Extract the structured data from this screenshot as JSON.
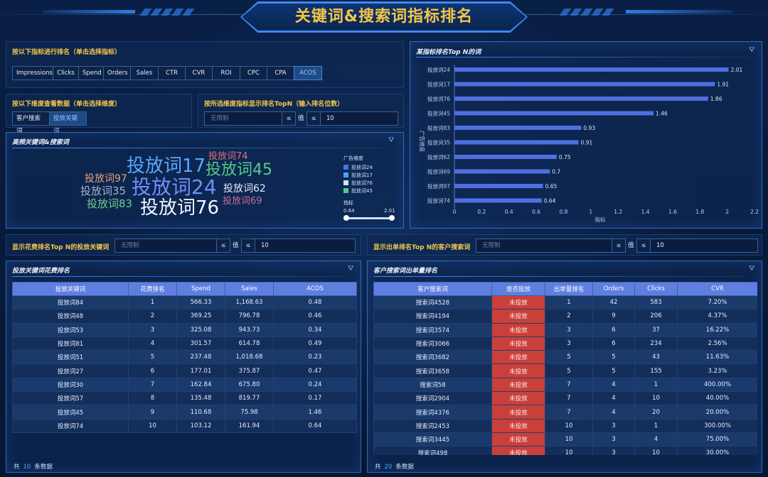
{
  "header": {
    "title": "关键词&搜索词指标排名"
  },
  "metric_selector": {
    "label": "按以下指标进行排名（单击选择指标）",
    "options": [
      "Impressions",
      "Clicks",
      "Spend",
      "Orders",
      "Sales",
      "CTR",
      "CVR",
      "ROI",
      "CPC",
      "CPA",
      "ACOS"
    ],
    "selected": "ACOS"
  },
  "dimension_selector": {
    "label": "按以下维度查看数据（单击选择维度）",
    "options": [
      "客户搜索词",
      "投放关键词"
    ],
    "selected": "投放关键词"
  },
  "topn_filter": {
    "label": "按所选维度指标显示排名TopN（输入排名位数）",
    "placeholder": "无限制",
    "op_icon": "≤",
    "value_label": "值",
    "value": "10"
  },
  "word_cloud": {
    "title": "高频关键词&搜索词",
    "words": [
      {
        "text": "投放词74",
        "color": "#e0707a"
      },
      {
        "text": "投放词17",
        "color": "#5aa7ff"
      },
      {
        "text": "投放词45",
        "color": "#56c98a"
      },
      {
        "text": "投放词97",
        "color": "#e8a07a"
      },
      {
        "text": "投放词24",
        "color": "#6f8fff"
      },
      {
        "text": "投放词62",
        "color": "#e4ecff"
      },
      {
        "text": "投放词35",
        "color": "#a7b3cf"
      },
      {
        "text": "投放词69",
        "color": "#c76ca0"
      },
      {
        "text": "投放词83",
        "color": "#71d08c"
      },
      {
        "text": "投放词76",
        "color": "#f2f6ff"
      }
    ],
    "legend_title": "广告维度",
    "legend": [
      {
        "label": "投放词24",
        "color": "#4f6fe0"
      },
      {
        "label": "投放词17",
        "color": "#4aa2ff"
      },
      {
        "label": "投放词76",
        "color": "#cfe2ff"
      },
      {
        "label": "投放词45",
        "color": "#56c98a"
      }
    ],
    "slider_title": "指标",
    "slider_min": "0.64",
    "slider_max": "2.01"
  },
  "bar_panel": {
    "title": "某指标排名Top  N的词"
  },
  "chart_data": {
    "type": "bar",
    "orientation": "horizontal",
    "categories": [
      "投放词24",
      "投放词17",
      "投放词76",
      "投放词45",
      "投放词83",
      "投放词35",
      "投放词62",
      "投放词69",
      "投放词97",
      "投放词74"
    ],
    "values": [
      2.01,
      1.91,
      1.86,
      1.46,
      0.93,
      0.91,
      0.75,
      0.7,
      0.65,
      0.64
    ],
    "data_labels": [
      "2.01",
      "1.91",
      "1.86",
      "1.46",
      "0.93",
      "0.91",
      "0.75",
      "0.7",
      "0.65",
      "0.64"
    ],
    "ylabel": "广告维度",
    "xlabel": "指标",
    "xlim": [
      0,
      2.2
    ],
    "x_ticks": [
      "0",
      "0.2",
      "0.4",
      "0.6",
      "0.8",
      "1",
      "1.2",
      "1.4",
      "1.6",
      "1.8",
      "2",
      "2.2"
    ],
    "color": "#4f6fe0"
  },
  "spend_filter": {
    "label": "显示花费排名Top N的投放关键词",
    "placeholder": "无限制",
    "op_icon": "≤",
    "value_label": "值",
    "value": "10"
  },
  "orders_filter": {
    "label": "显示出单排名Top N的客户搜索词",
    "placeholder": "无限制",
    "op_icon": "≤",
    "value_label": "值",
    "value": "10"
  },
  "spend_table": {
    "title": "投放关键词花费排名",
    "columns": [
      "投放关键词",
      "花费排名",
      "Spend",
      "Sales",
      "ACOS"
    ],
    "rows": [
      [
        "投放词84",
        "1",
        "566.33",
        "1,168.63",
        "0.48"
      ],
      [
        "投放词48",
        "2",
        "369.25",
        "796.78",
        "0.46"
      ],
      [
        "投放词53",
        "3",
        "325.08",
        "943.73",
        "0.34"
      ],
      [
        "投放词81",
        "4",
        "301.57",
        "614.78",
        "0.49"
      ],
      [
        "投放词51",
        "5",
        "237.48",
        "1,018.68",
        "0.23"
      ],
      [
        "投放词27",
        "6",
        "177.01",
        "375.87",
        "0.47"
      ],
      [
        "投放词30",
        "7",
        "162.84",
        "675.80",
        "0.24"
      ],
      [
        "投放词57",
        "8",
        "135.48",
        "819.77",
        "0.17"
      ],
      [
        "投放词45",
        "9",
        "110.68",
        "75.98",
        "1.46"
      ],
      [
        "投放词74",
        "10",
        "103.12",
        "161.94",
        "0.64"
      ]
    ],
    "footer_prefix": "共",
    "footer_count": "10",
    "footer_suffix": "条数据"
  },
  "orders_table": {
    "title": "客户搜索词出单量排名",
    "columns": [
      "客户搜索词",
      "是否投放",
      "出单量排名",
      "Orders",
      "Clicks",
      "CVR"
    ],
    "rows": [
      [
        "搜索词4528",
        "未投放",
        "1",
        "42",
        "583",
        "7.20%"
      ],
      [
        "搜索词4194",
        "未投放",
        "2",
        "9",
        "206",
        "4.37%"
      ],
      [
        "搜索词3574",
        "未投放",
        "3",
        "6",
        "37",
        "16.22%"
      ],
      [
        "搜索词3066",
        "未投放",
        "3",
        "6",
        "234",
        "2.56%"
      ],
      [
        "搜索词3682",
        "未投放",
        "5",
        "5",
        "43",
        "11.63%"
      ],
      [
        "搜索词3658",
        "未投放",
        "5",
        "5",
        "155",
        "3.23%"
      ],
      [
        "搜索词58",
        "未投放",
        "7",
        "4",
        "1",
        "400.00%"
      ],
      [
        "搜索词2904",
        "未投放",
        "7",
        "4",
        "10",
        "40.00%"
      ],
      [
        "搜索词4376",
        "未投放",
        "7",
        "4",
        "20",
        "20.00%"
      ],
      [
        "搜索词2453",
        "未投放",
        "10",
        "3",
        "1",
        "300.00%"
      ],
      [
        "搜索词3445",
        "未投放",
        "10",
        "3",
        "4",
        "75.00%"
      ],
      [
        "搜索词498",
        "未投放",
        "10",
        "3",
        "10",
        "30.00%"
      ]
    ],
    "footer_prefix": "共",
    "footer_count": "20",
    "footer_suffix": "条数据"
  }
}
